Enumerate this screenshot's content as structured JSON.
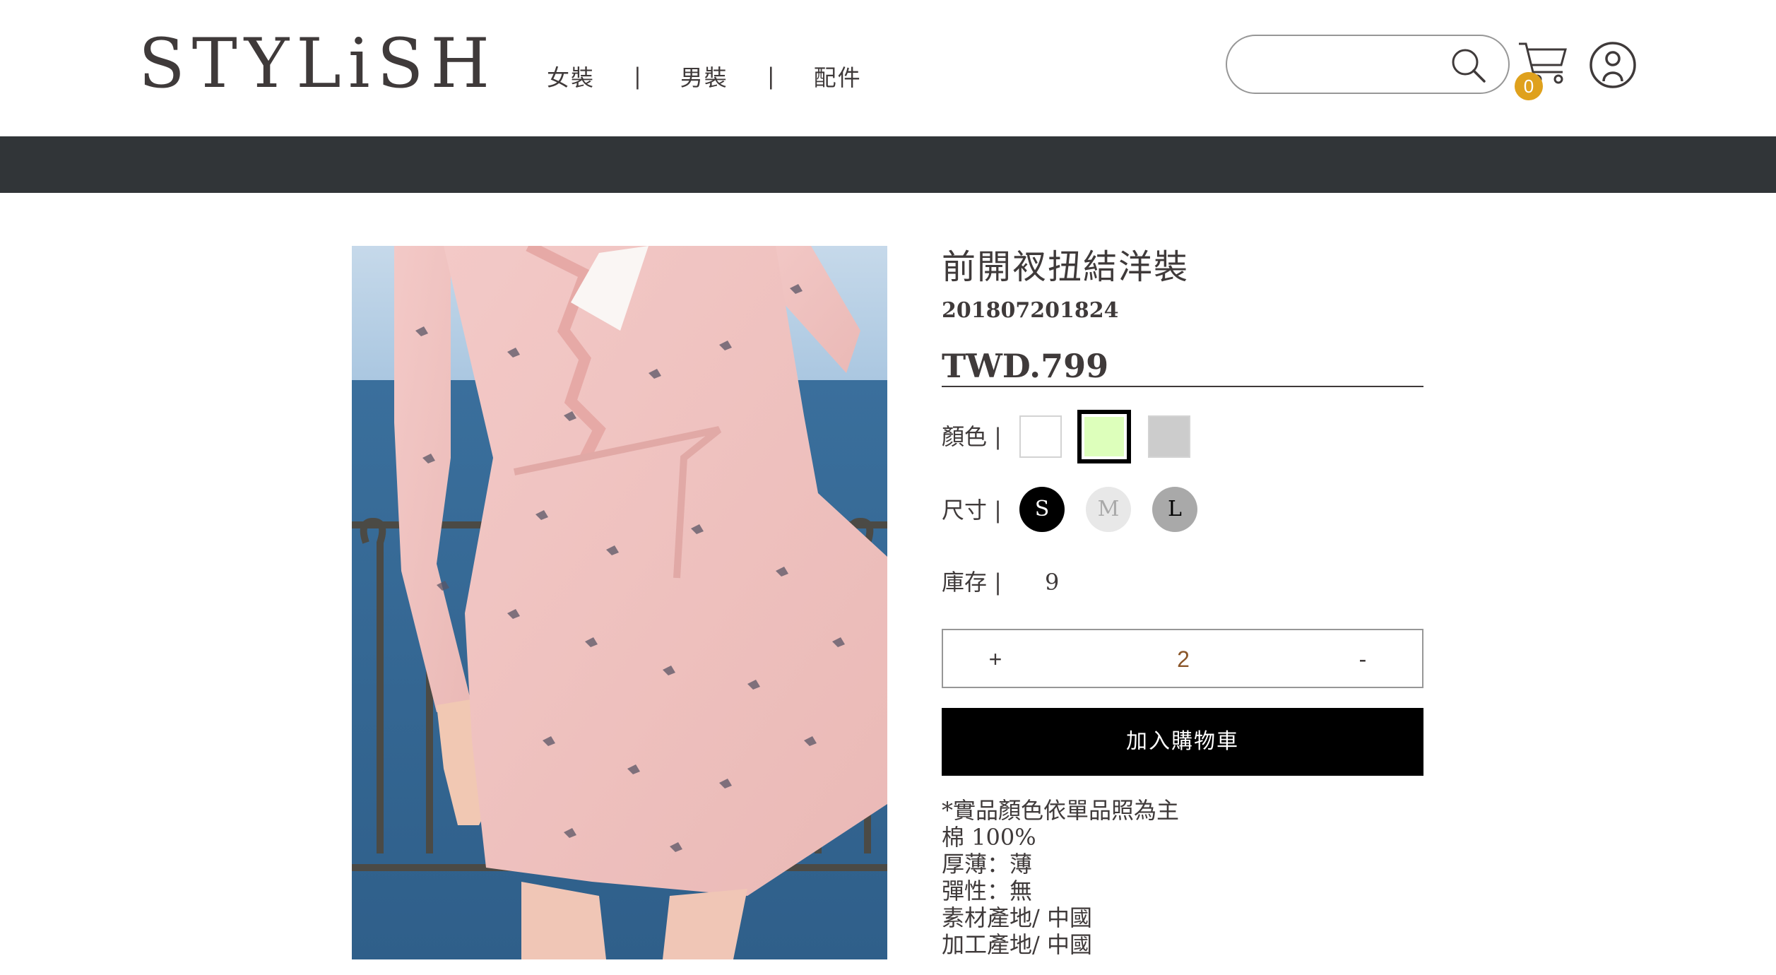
{
  "header": {
    "logo": "STYLiSH",
    "nav": [
      "女裝",
      "男裝",
      "配件"
    ],
    "separator": "|",
    "search_placeholder": "",
    "cart_count": "0"
  },
  "product": {
    "title": "前開衩扭結洋裝",
    "id": "201807201824",
    "price": "TWD.799",
    "color_label": "顏色 |",
    "colors": [
      "#FFFFFF",
      "#DDFFBB",
      "#CCCCCC"
    ],
    "selected_color": "#DDFFBB",
    "size_label": "尺寸 |",
    "sizes": [
      "S",
      "M",
      "L"
    ],
    "selected_size": "S",
    "stock_label": "庫存 |",
    "stock": "9",
    "qty_plus": "+",
    "qty_value": "2",
    "qty_minus": "-",
    "add_to_cart": "加入購物車",
    "notes": [
      "*實品顏色依單品照為主",
      "棉 100%",
      "厚薄：薄",
      "彈性：無",
      "素材產地/ 中國",
      "加工產地/ 中國"
    ]
  },
  "colors_ui": {
    "accent_dark": "#313538",
    "badge": "#dfa11d",
    "quantity_text": "#8b572a"
  }
}
